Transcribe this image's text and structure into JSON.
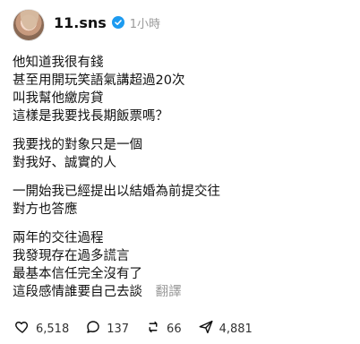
{
  "post": {
    "username": "11.sns",
    "time": "1小時",
    "content": {
      "paragraphs": [
        [
          "他知道我很有錢",
          "甚至用開玩笑語氣講超過20次",
          "叫我幫他繳房貸",
          "這樣是我要找長期飯票嗎？"
        ],
        [
          "我要找的對象只是一個",
          "對我好、誠實的人"
        ],
        [
          "一開始我已經提出以結婚為前提交往",
          "對方也答應"
        ],
        [
          "兩年的交往過程",
          "我發現存在過多謊言",
          "最基本信任完全沒有了",
          "這段感情誰要自己去談"
        ]
      ],
      "translate_label": "翻譯"
    },
    "actions": {
      "likes": "6,518",
      "comments": "137",
      "reposts": "66",
      "shares": "4,881"
    }
  }
}
